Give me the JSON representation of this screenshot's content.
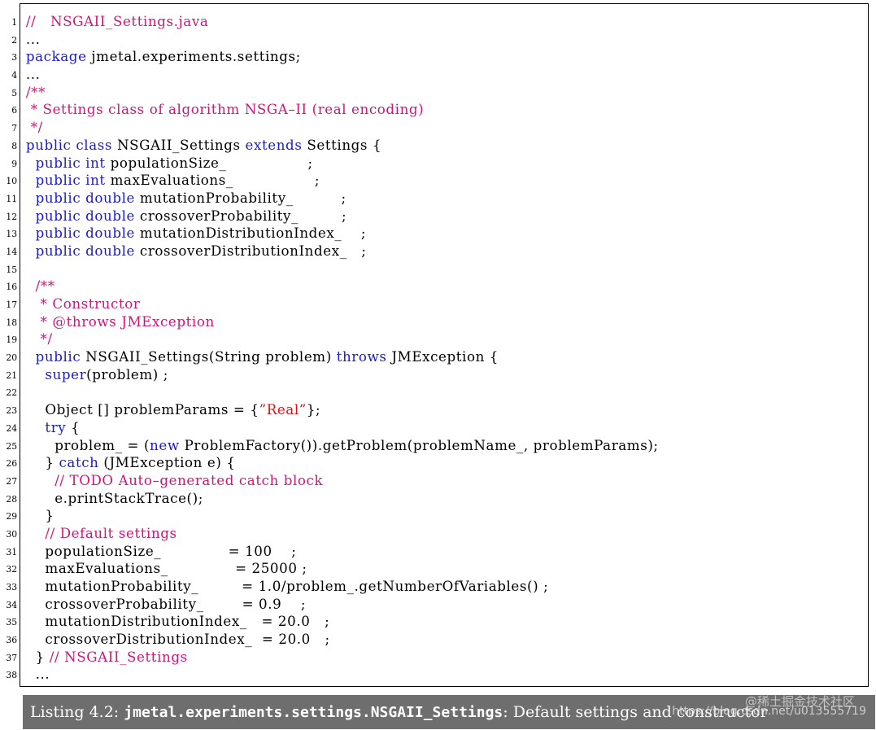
{
  "listing": {
    "lines": [
      {
        "n": "1",
        "tokens": [
          [
            "comment",
            "//   NSGAII_Settings.java"
          ]
        ]
      },
      {
        "n": "2",
        "tokens": [
          [
            "plain",
            "..."
          ]
        ]
      },
      {
        "n": "3",
        "tokens": [
          [
            "keyword",
            "package"
          ],
          [
            "plain",
            " jmetal.experiments.settings;"
          ]
        ]
      },
      {
        "n": "4",
        "tokens": [
          [
            "plain",
            "..."
          ]
        ]
      },
      {
        "n": "5",
        "tokens": [
          [
            "comment",
            "/**"
          ]
        ]
      },
      {
        "n": "6",
        "tokens": [
          [
            "comment",
            " * Settings class of algorithm NSGA–II (real encoding)"
          ]
        ]
      },
      {
        "n": "7",
        "tokens": [
          [
            "comment",
            " */"
          ]
        ]
      },
      {
        "n": "8",
        "tokens": [
          [
            "keyword",
            "public class"
          ],
          [
            "plain",
            " NSGAII_Settings "
          ],
          [
            "keyword",
            "extends"
          ],
          [
            "plain",
            " Settings {"
          ]
        ]
      },
      {
        "n": "9",
        "tokens": [
          [
            "plain",
            "  "
          ],
          [
            "keyword",
            "public int"
          ],
          [
            "plain",
            " populationSize_                 ;"
          ]
        ]
      },
      {
        "n": "10",
        "tokens": [
          [
            "plain",
            "  "
          ],
          [
            "keyword",
            "public int"
          ],
          [
            "plain",
            " maxEvaluations_                 ;"
          ]
        ]
      },
      {
        "n": "11",
        "tokens": [
          [
            "plain",
            "  "
          ],
          [
            "keyword",
            "public double"
          ],
          [
            "plain",
            " mutationProbability_          ;"
          ]
        ]
      },
      {
        "n": "12",
        "tokens": [
          [
            "plain",
            "  "
          ],
          [
            "keyword",
            "public double"
          ],
          [
            "plain",
            " crossoverProbability_         ;"
          ]
        ]
      },
      {
        "n": "13",
        "tokens": [
          [
            "plain",
            "  "
          ],
          [
            "keyword",
            "public double"
          ],
          [
            "plain",
            " mutationDistributionIndex_    ;"
          ]
        ]
      },
      {
        "n": "14",
        "tokens": [
          [
            "plain",
            "  "
          ],
          [
            "keyword",
            "public double"
          ],
          [
            "plain",
            " crossoverDistributionIndex_   ;"
          ]
        ]
      },
      {
        "n": "15",
        "tokens": []
      },
      {
        "n": "16",
        "tokens": [
          [
            "plain",
            "  "
          ],
          [
            "comment",
            "/**"
          ]
        ]
      },
      {
        "n": "17",
        "tokens": [
          [
            "plain",
            "  "
          ],
          [
            "comment",
            " * Constructor"
          ]
        ]
      },
      {
        "n": "18",
        "tokens": [
          [
            "plain",
            "  "
          ],
          [
            "comment",
            " * @throws JMException"
          ]
        ]
      },
      {
        "n": "19",
        "tokens": [
          [
            "plain",
            "  "
          ],
          [
            "comment",
            " */"
          ]
        ]
      },
      {
        "n": "20",
        "tokens": [
          [
            "plain",
            "  "
          ],
          [
            "keyword",
            "public"
          ],
          [
            "plain",
            " NSGAII_Settings(String problem) "
          ],
          [
            "keyword",
            "throws"
          ],
          [
            "plain",
            " JMException {"
          ]
        ]
      },
      {
        "n": "21",
        "tokens": [
          [
            "plain",
            "    "
          ],
          [
            "keyword",
            "super"
          ],
          [
            "plain",
            "(problem) ;"
          ]
        ]
      },
      {
        "n": "22",
        "tokens": []
      },
      {
        "n": "23",
        "tokens": [
          [
            "plain",
            "    Object [] problemParams = {"
          ],
          [
            "string",
            "”Real”"
          ],
          [
            "plain",
            "};"
          ]
        ]
      },
      {
        "n": "24",
        "tokens": [
          [
            "plain",
            "    "
          ],
          [
            "keyword",
            "try"
          ],
          [
            "plain",
            " {"
          ]
        ]
      },
      {
        "n": "25",
        "tokens": [
          [
            "plain",
            "      problem_ = ("
          ],
          [
            "keyword",
            "new"
          ],
          [
            "plain",
            " ProblemFactory()).getProblem(problemName_, problemParams);"
          ]
        ]
      },
      {
        "n": "26",
        "tokens": [
          [
            "plain",
            "    } "
          ],
          [
            "keyword",
            "catch"
          ],
          [
            "plain",
            " (JMException e) {"
          ]
        ]
      },
      {
        "n": "27",
        "tokens": [
          [
            "plain",
            "      "
          ],
          [
            "comment",
            "// TODO Auto–generated catch block"
          ]
        ]
      },
      {
        "n": "28",
        "tokens": [
          [
            "plain",
            "      e.printStackTrace();"
          ]
        ]
      },
      {
        "n": "29",
        "tokens": [
          [
            "plain",
            "    }"
          ]
        ]
      },
      {
        "n": "30",
        "tokens": [
          [
            "plain",
            "    "
          ],
          [
            "comment",
            "// Default settings"
          ]
        ]
      },
      {
        "n": "31",
        "tokens": [
          [
            "plain",
            "    populationSize_              = 100    ;"
          ]
        ]
      },
      {
        "n": "32",
        "tokens": [
          [
            "plain",
            "    maxEvaluations_              = 25000 ;"
          ]
        ]
      },
      {
        "n": "33",
        "tokens": [
          [
            "plain",
            "    mutationProbability_         = 1.0/problem_.getNumberOfVariables() ;"
          ]
        ]
      },
      {
        "n": "34",
        "tokens": [
          [
            "plain",
            "    crossoverProbability_        = 0.9    ;"
          ]
        ]
      },
      {
        "n": "35",
        "tokens": [
          [
            "plain",
            "    mutationDistributionIndex_   = 20.0   ;"
          ]
        ]
      },
      {
        "n": "36",
        "tokens": [
          [
            "plain",
            "    crossoverDistributionIndex_  = 20.0   ;"
          ]
        ]
      },
      {
        "n": "37",
        "tokens": [
          [
            "plain",
            "  } "
          ],
          [
            "comment",
            "// NSGAII_Settings"
          ]
        ]
      },
      {
        "n": "38",
        "tokens": [
          [
            "plain",
            "  ..."
          ]
        ]
      }
    ]
  },
  "caption": {
    "prefix": "Listing 4.2: ",
    "classname": "jmetal.experiments.settings.NSGAII_Settings",
    "suffix": ": Default settings and constructor"
  },
  "watermark": {
    "top": "@稀土掘金技术社区",
    "bottom": "https://blog.csdn.net/u013555719"
  },
  "colors": {
    "keyword": "#1a1ad0",
    "comment": "#d0147a",
    "string": "#e01010",
    "caption_bg": "#6e6e6e"
  }
}
